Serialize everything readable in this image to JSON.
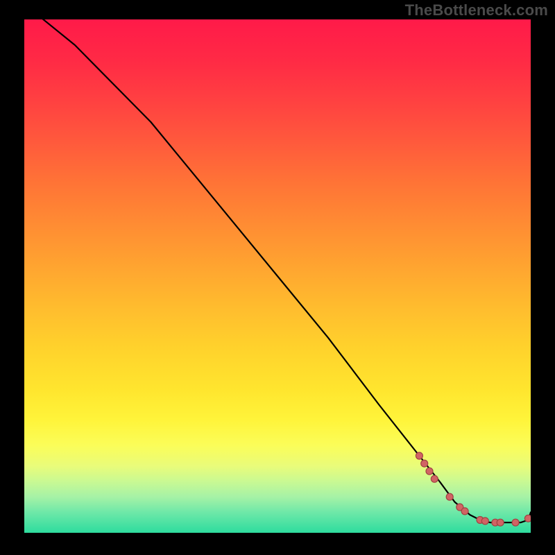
{
  "branding": {
    "watermark": "TheBottleneck.com"
  },
  "chart_data": {
    "type": "line",
    "title": "",
    "xlabel": "",
    "ylabel": "",
    "xlim": [
      0,
      100
    ],
    "ylim": [
      0,
      100
    ],
    "grid": false,
    "legend": false,
    "gradient_background": {
      "direction": "vertical",
      "stops": [
        {
          "pos": 0,
          "color": "#ff1a49"
        },
        {
          "pos": 25,
          "color": "#ff6a38"
        },
        {
          "pos": 50,
          "color": "#ffb02e"
        },
        {
          "pos": 75,
          "color": "#fff138"
        },
        {
          "pos": 100,
          "color": "#2edc9e"
        }
      ]
    },
    "series": [
      {
        "name": "bottleneck-curve",
        "color": "#000000",
        "x": [
          0,
          10,
          20,
          25,
          30,
          40,
          50,
          60,
          70,
          78,
          82,
          85,
          88,
          90,
          92,
          94,
          96,
          98,
          99.5,
          100
        ],
        "y": [
          103,
          95,
          85,
          80,
          74,
          62,
          50,
          38,
          25,
          15,
          10,
          6,
          3.5,
          2.5,
          2,
          2,
          2,
          2,
          2.5,
          4
        ]
      }
    ],
    "markers": {
      "name": "highlight-points",
      "color": "#d16464",
      "x": [
        78,
        79,
        80,
        81,
        84,
        86,
        87,
        90,
        91,
        93,
        94,
        97,
        99.5
      ],
      "y": [
        15,
        13.5,
        12,
        10.5,
        7,
        5,
        4.2,
        2.5,
        2.3,
        2,
        2,
        2,
        2.8
      ]
    }
  }
}
